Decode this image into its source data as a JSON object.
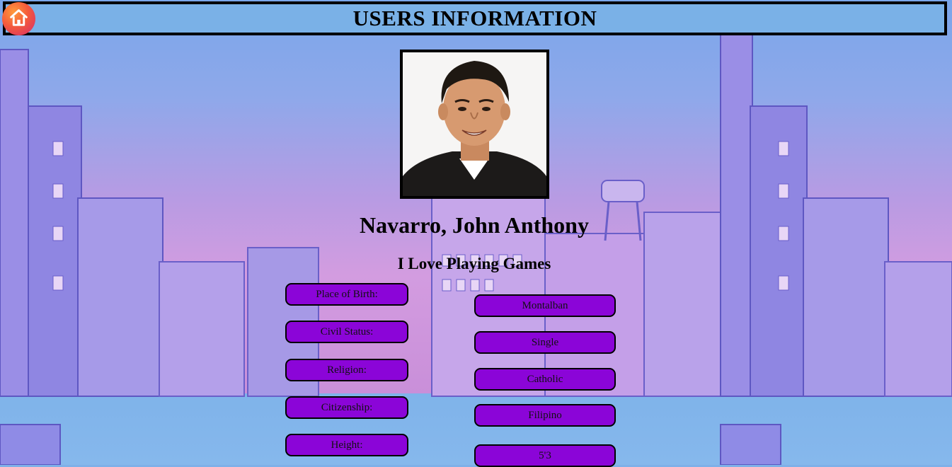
{
  "header": {
    "title": "USERS INFORMATION",
    "home_icon": "home-icon"
  },
  "profile": {
    "name": "Navarro, John Anthony",
    "motto": "I Love Playing Games"
  },
  "details": [
    {
      "label": "Place of Birth:",
      "value": "Montalban"
    },
    {
      "label": "Civil Status:",
      "value": "Single"
    },
    {
      "label": "Religion:",
      "value": "Catholic"
    },
    {
      "label": "Citizenship:",
      "value": "Filipino"
    },
    {
      "label": "Height:",
      "value": "5'3"
    }
  ],
  "colors": {
    "pill_fill": "#8b05d8",
    "header_fill": "#7ab1e7",
    "home_gradient_start": "#ff9a3c",
    "home_gradient_end": "#d62a6e"
  }
}
